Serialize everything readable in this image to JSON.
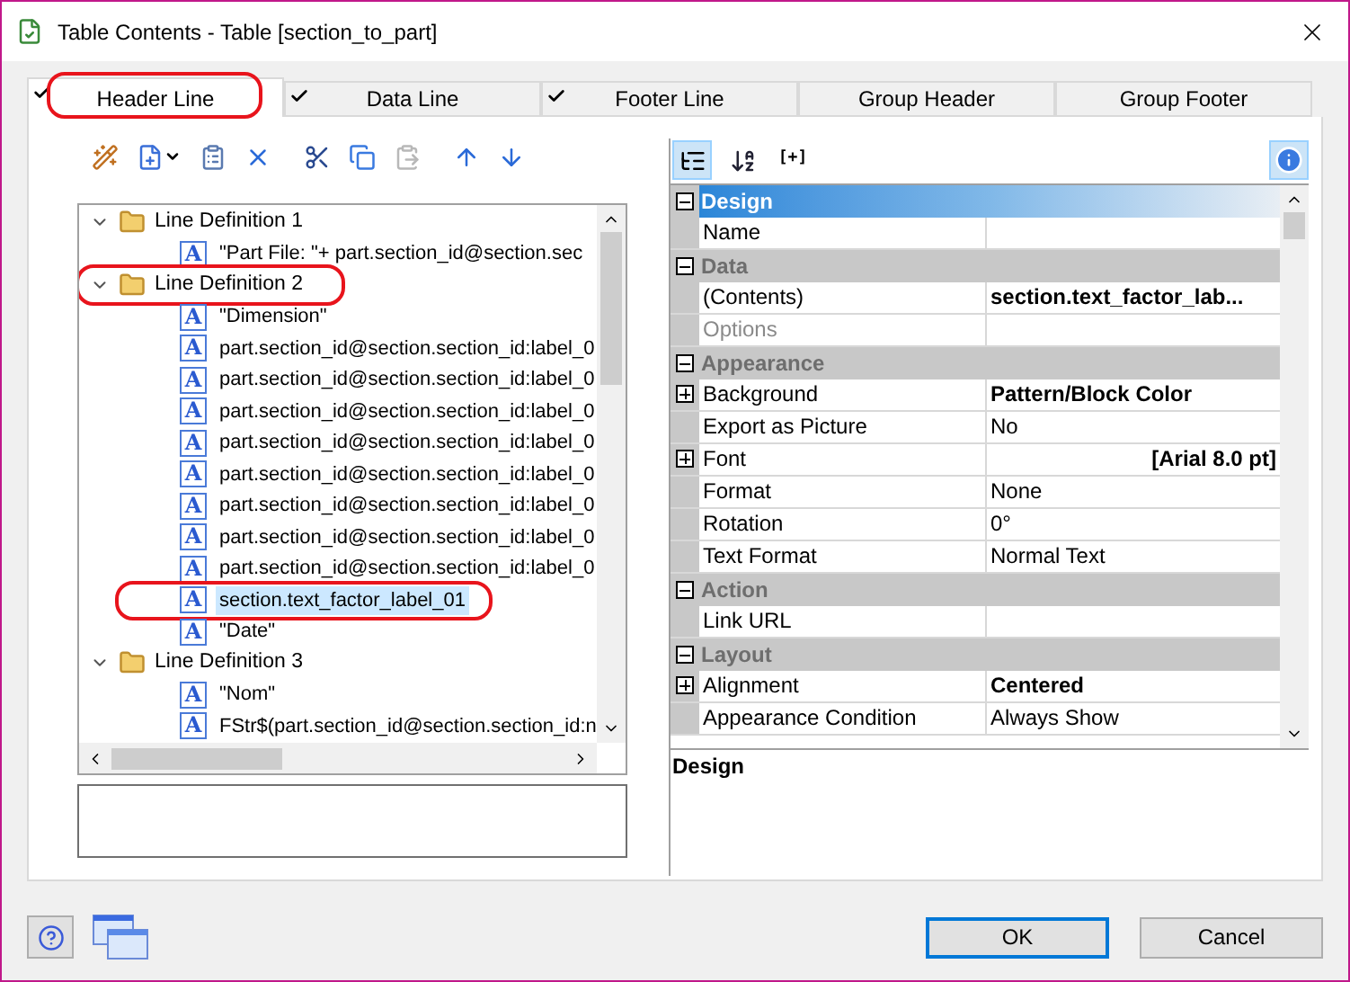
{
  "window": {
    "title": "Table Contents - Table [section_to_part]"
  },
  "tabs": [
    {
      "label": "Header Line",
      "checked": true,
      "selected": true,
      "circled": true
    },
    {
      "label": "Data Line",
      "checked": true,
      "selected": false,
      "circled": false
    },
    {
      "label": "Footer Line",
      "checked": true,
      "selected": false,
      "circled": false
    },
    {
      "label": "Group Header",
      "checked": false,
      "selected": false,
      "circled": false
    },
    {
      "label": "Group Footer",
      "checked": false,
      "selected": false,
      "circled": false
    }
  ],
  "left_toolbar": [
    {
      "kind": "wizard",
      "disabled": false
    },
    {
      "kind": "new",
      "disabled": false
    },
    {
      "kind": "properties",
      "disabled": false
    },
    {
      "kind": "delete",
      "disabled": false
    },
    {
      "kind": "cut",
      "disabled": false
    },
    {
      "kind": "copy",
      "disabled": false
    },
    {
      "kind": "paste",
      "disabled": true
    },
    {
      "kind": "up",
      "disabled": false
    },
    {
      "kind": "down",
      "disabled": false
    }
  ],
  "tree": [
    {
      "label": "Line Definition  1",
      "expanded": true,
      "selected": false,
      "circled": false,
      "children": [
        {
          "label": "\"Part File:   \"+ part.section_id@section.sec",
          "glyph": "A",
          "selected": false,
          "circled": false
        }
      ]
    },
    {
      "label": "Line Definition  2",
      "expanded": true,
      "selected": false,
      "circled": true,
      "children": [
        {
          "label": "\"Dimension\"",
          "glyph": "A",
          "selected": false,
          "circled": false
        },
        {
          "label": "part.section_id@section.section_id:label_0",
          "glyph": "A",
          "selected": false,
          "circled": false
        },
        {
          "label": "part.section_id@section.section_id:label_0",
          "glyph": "A",
          "selected": false,
          "circled": false
        },
        {
          "label": "part.section_id@section.section_id:label_0",
          "glyph": "A",
          "selected": false,
          "circled": false
        },
        {
          "label": "part.section_id@section.section_id:label_0",
          "glyph": "A",
          "selected": false,
          "circled": false
        },
        {
          "label": "part.section_id@section.section_id:label_0",
          "glyph": "A",
          "selected": false,
          "circled": false
        },
        {
          "label": "part.section_id@section.section_id:label_0",
          "glyph": "A",
          "selected": false,
          "circled": false
        },
        {
          "label": "part.section_id@section.section_id:label_0",
          "glyph": "A",
          "selected": false,
          "circled": false
        },
        {
          "label": "part.section_id@section.section_id:label_0",
          "glyph": "A",
          "selected": false,
          "circled": false
        },
        {
          "label": "section.text_factor_label_01",
          "glyph": "A",
          "selected": true,
          "circled": true
        },
        {
          "label": "\"Date\"",
          "glyph": "A",
          "selected": false,
          "circled": false
        }
      ]
    },
    {
      "label": "Line Definition  3",
      "expanded": true,
      "selected": false,
      "circled": false,
      "children": [
        {
          "label": "\"Nom\"",
          "glyph": "A",
          "selected": false,
          "circled": false
        },
        {
          "label": "FStr$(part.section_id@section.section_id:n",
          "glyph": "A",
          "selected": false,
          "circled": false
        }
      ]
    }
  ],
  "right_toolbar": [
    {
      "kind": "categorized",
      "selected": true
    },
    {
      "kind": "sort",
      "selected": false
    },
    {
      "kind": "expand",
      "label": "[+]",
      "selected": false
    }
  ],
  "info_button": {
    "selected": true
  },
  "properties": [
    {
      "kind": "category",
      "name": "Design",
      "selected": true
    },
    {
      "kind": "property",
      "name": "Name",
      "expandable": false,
      "disabled": false
    },
    {
      "kind": "category",
      "name": "Data",
      "selected": false
    },
    {
      "kind": "property",
      "name": "(Contents)",
      "value": "section.text_factor_lab...",
      "expandable": false,
      "bold": true,
      "disabled": false
    },
    {
      "kind": "property",
      "name": "Options",
      "expandable": false,
      "disabled": true
    },
    {
      "kind": "category",
      "name": "Appearance",
      "selected": false
    },
    {
      "kind": "property",
      "name": "Background",
      "value": "Pattern/Block Color",
      "expandable": true,
      "bold": true,
      "disabled": false
    },
    {
      "kind": "property",
      "name": "Export as Picture",
      "value": "No",
      "expandable": false,
      "bold": false,
      "disabled": false
    },
    {
      "kind": "property",
      "name": "Font",
      "value": "[Arial 8.0 pt]",
      "expandable": true,
      "bold": true,
      "disabled": false,
      "right_aligned": true
    },
    {
      "kind": "property",
      "name": "Format",
      "value": "None",
      "expandable": false,
      "bold": false,
      "disabled": false
    },
    {
      "kind": "property",
      "name": "Rotation",
      "value": "0°",
      "expandable": false,
      "bold": false,
      "disabled": false
    },
    {
      "kind": "property",
      "name": "Text Format",
      "value": "Normal Text",
      "expandable": false,
      "bold": false,
      "disabled": false
    },
    {
      "kind": "category",
      "name": "Action",
      "selected": false
    },
    {
      "kind": "property",
      "name": "Link URL",
      "expandable": false,
      "disabled": false
    },
    {
      "kind": "category",
      "name": "Layout",
      "selected": false
    },
    {
      "kind": "property",
      "name": "Alignment",
      "value": "Centered",
      "expandable": true,
      "bold": true,
      "disabled": false
    },
    {
      "kind": "property",
      "name": "Appearance Condition",
      "value": "Always Show",
      "expandable": false,
      "bold": false,
      "disabled": false
    }
  ],
  "description": {
    "title": "Design"
  },
  "buttons": [
    {
      "label": "OK",
      "default": true
    },
    {
      "label": "Cancel",
      "default": false
    }
  ]
}
